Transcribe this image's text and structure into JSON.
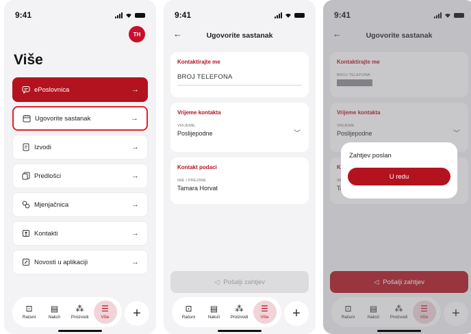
{
  "status": {
    "time": "9:41"
  },
  "screen1": {
    "avatar_initials": "TH",
    "title": "Više",
    "menu": [
      {
        "label": "ePoslovnica"
      },
      {
        "label": "Ugovorite sastanak"
      },
      {
        "label": "Izvodi"
      },
      {
        "label": "Predlošci"
      },
      {
        "label": "Mjenjačnica"
      },
      {
        "label": "Kontakti"
      },
      {
        "label": "Novosti u aplikaciji"
      }
    ]
  },
  "form": {
    "title": "Ugovorite sastanak",
    "contact_header": "Kontaktirajte me",
    "phone_placeholder": "BROJ TELEFONA",
    "phone_label": "BROJ TELEFONA",
    "time_header": "Vrijeme kontakta",
    "time_label": "VRIJEME",
    "time_value": "Poslijepodne",
    "details_header": "Kontakt podaci",
    "name_label": "IME I PREZIME",
    "name_value": "Tamara Horvat",
    "send_label": "Pošalji zahtjev"
  },
  "dialog": {
    "title": "Zahtjev poslan",
    "ok_label": "U redu"
  },
  "tabbar": {
    "items": [
      {
        "label": "Računi"
      },
      {
        "label": "Nalozi"
      },
      {
        "label": "Proizvodi"
      },
      {
        "label": "Više"
      }
    ]
  },
  "colors": {
    "accent": "#b3131f",
    "highlight_border": "#e0202a"
  }
}
